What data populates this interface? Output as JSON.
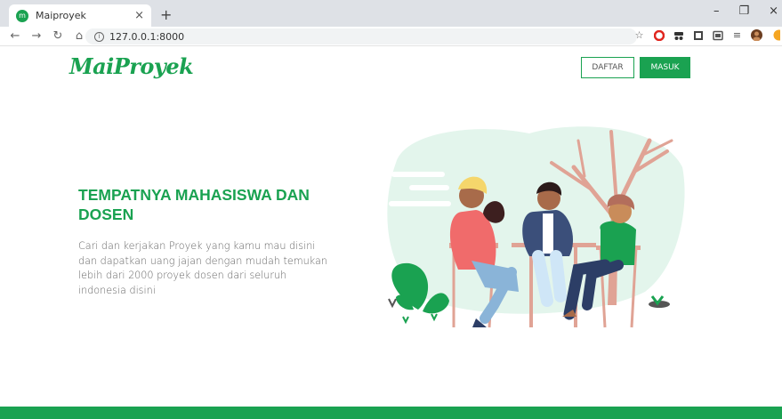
{
  "browser": {
    "tab_title": "Maiproyek",
    "tab_close": "×",
    "new_tab": "+",
    "url": "127.0.0.1:8000",
    "win_minimize": "–",
    "win_restore": "❐",
    "win_close": "×"
  },
  "header": {
    "logo": "MaiProyek",
    "register_label": "DAFTAR",
    "login_label": "MASUK"
  },
  "hero": {
    "title": "TEMPATNYA MAHASISWA DAN DOSEN",
    "description": "Cari dan kerjakan Proyek yang kamu mau disini dan dapatkan uang jajan dengan mudah temukan lebih dari 2000 proyek dosen dari seluruh indonesia disini"
  },
  "colors": {
    "accent": "#1aa251",
    "illustration_bg": "#e3f5ec",
    "tree": "#e0a395"
  },
  "icons": {
    "back": "arrow-left-icon",
    "forward": "arrow-right-icon",
    "reload": "reload-icon",
    "home": "home-icon",
    "bookmark": "star-icon"
  }
}
